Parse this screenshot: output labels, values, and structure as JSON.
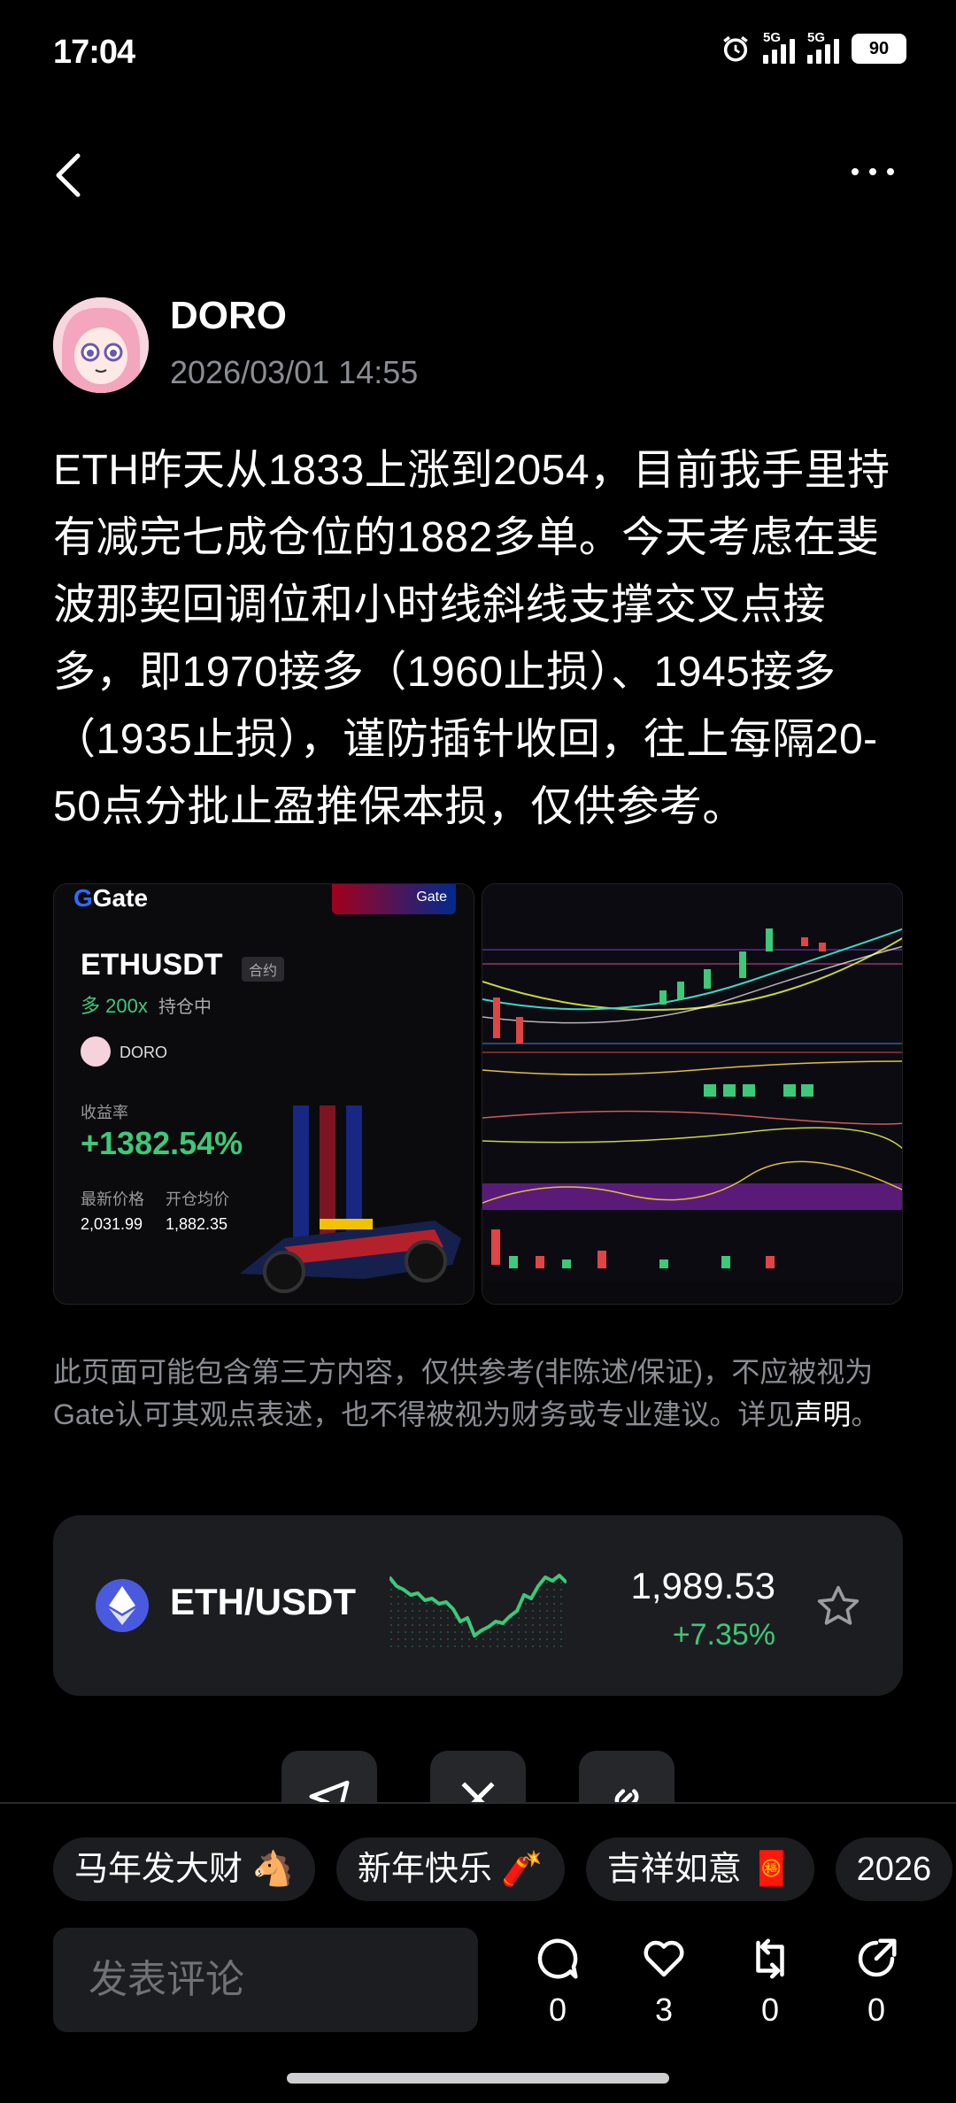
{
  "status_bar": {
    "time": "17:04",
    "network_1": "5G",
    "network_2": "5G",
    "battery": "90"
  },
  "nav": {
    "back_icon": "chevron-left-icon",
    "more_icon": "more-horizontal-icon"
  },
  "author": {
    "name": "DORO",
    "timestamp": "2026/03/01 14:55"
  },
  "post": {
    "text": "ETH昨天从1833上涨到2054，目前我手里持有减完七成仓位的1882多单。今天考虑在斐波那契回调位和小时线斜线支撑交叉点接多，即1970接多（1960止损）、1945接多（1935止损），谨防插针收回，往上每隔20-50点分批止盈推保本损，仅供参考。"
  },
  "image_card": {
    "brand": "Gate",
    "badge": "Gate",
    "symbol": "ETHUSDT",
    "contract_tag": "合约",
    "leverage": "多 200x",
    "position_status": "持仓中",
    "user": "DORO",
    "roi_label": "收益率",
    "roi_value": "+1382.54%",
    "latest_price_label": "最新价格",
    "latest_price": "2,031.99",
    "entry_price_label": "开仓均价",
    "entry_price": "1,882.35"
  },
  "disclaimer": {
    "text": "此页面可能包含第三方内容，仅供参考(非陈述/保证)，不应被视为Gate认可其观点表述，也不得被视为财务或专业建议。详见",
    "link": "声明",
    "end": "。"
  },
  "ticker": {
    "pair": "ETH/USDT",
    "price": "1,989.53",
    "change": "+7.35%",
    "change_color": "#3ec879"
  },
  "tags": [
    {
      "label": "马年发大财 🐴"
    },
    {
      "label": "新年快乐 🧨"
    },
    {
      "label": "吉祥如意 🧧"
    },
    {
      "label": "2026"
    }
  ],
  "comment": {
    "placeholder": "发表评论"
  },
  "actions": {
    "comment_count": "0",
    "like_count": "3",
    "repost_count": "0",
    "share_count": "0"
  }
}
